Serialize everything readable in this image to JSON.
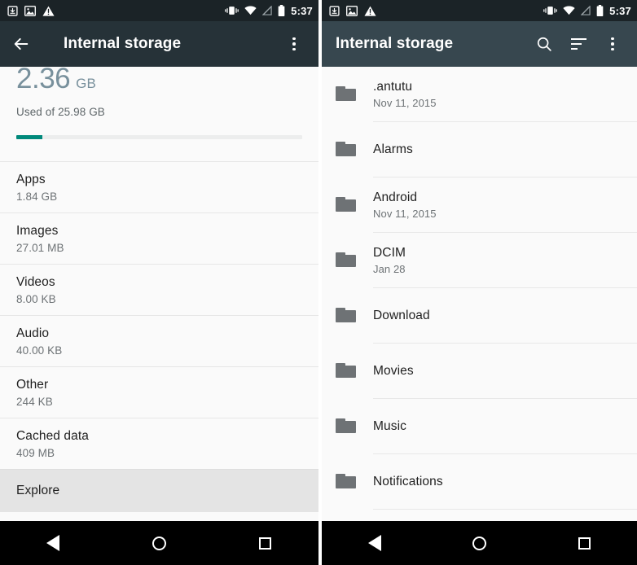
{
  "statusbar": {
    "time": "5:37",
    "left_icons": [
      "download-icon",
      "image-icon",
      "warning-icon"
    ],
    "right_icons": [
      "vibrate-icon",
      "wifi-icon",
      "no-signal-icon",
      "battery-icon"
    ]
  },
  "left_screen": {
    "toolbar": {
      "title": "Internal storage",
      "back_label": "Back",
      "overflow_label": "More options",
      "bg": "#263238"
    },
    "summary": {
      "amount": "2.36",
      "unit": "GB",
      "subtitle": "Used of 25.98 GB",
      "bar_percent": 9,
      "bar_color": "#00897b",
      "amount_color": "#78909c"
    },
    "rows": [
      {
        "title": "Apps",
        "value": "1.84 GB"
      },
      {
        "title": "Images",
        "value": "27.01 MB"
      },
      {
        "title": "Videos",
        "value": "8.00 KB"
      },
      {
        "title": "Audio",
        "value": "40.00 KB"
      },
      {
        "title": "Other",
        "value": "244 KB"
      },
      {
        "title": "Cached data",
        "value": "409 MB"
      }
    ],
    "explore": {
      "title": "Explore",
      "state": "pressed",
      "bg": "#e4e4e4"
    }
  },
  "right_screen": {
    "toolbar": {
      "title": "Internal storage",
      "search_label": "Search",
      "sort_label": "Sort",
      "overflow_label": "More options",
      "bg": "#37474f"
    },
    "files": [
      {
        "name": ".antutu",
        "date": "Nov 11, 2015",
        "icon": "folder-icon"
      },
      {
        "name": "Alarms",
        "date": "",
        "icon": "folder-icon"
      },
      {
        "name": "Android",
        "date": "Nov 11, 2015",
        "icon": "folder-icon"
      },
      {
        "name": "DCIM",
        "date": "Jan 28",
        "icon": "folder-icon"
      },
      {
        "name": "Download",
        "date": "",
        "icon": "folder-icon"
      },
      {
        "name": "Movies",
        "date": "",
        "icon": "folder-icon"
      },
      {
        "name": "Music",
        "date": "",
        "icon": "folder-icon"
      },
      {
        "name": "Notifications",
        "date": "",
        "icon": "folder-icon"
      }
    ]
  },
  "navbar": {
    "back_label": "Back",
    "home_label": "Home",
    "recents_label": "Recents"
  }
}
